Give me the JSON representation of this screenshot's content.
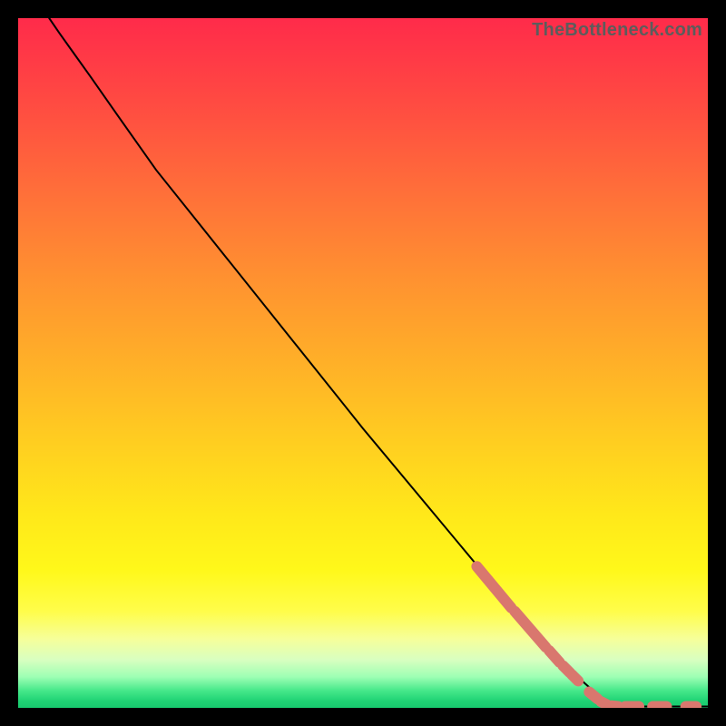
{
  "watermark": "TheBottleneck.com",
  "chart_data": {
    "type": "line",
    "title": "",
    "xlabel": "",
    "ylabel": "",
    "xlim": [
      0,
      100
    ],
    "ylim": [
      0,
      100
    ],
    "grid": false,
    "series": [
      {
        "name": "curve",
        "color": "#000000",
        "points": [
          {
            "x": 4.5,
            "y": 100
          },
          {
            "x": 6.0,
            "y": 97.8
          },
          {
            "x": 8.0,
            "y": 95.0
          },
          {
            "x": 10.5,
            "y": 91.5
          },
          {
            "x": 14.0,
            "y": 86.5
          },
          {
            "x": 20.0,
            "y": 78.0
          },
          {
            "x": 30.0,
            "y": 65.5
          },
          {
            "x": 40.0,
            "y": 53.0
          },
          {
            "x": 50.0,
            "y": 40.5
          },
          {
            "x": 60.0,
            "y": 28.5
          },
          {
            "x": 70.0,
            "y": 16.5
          },
          {
            "x": 80.0,
            "y": 5.5
          },
          {
            "x": 85.0,
            "y": 1.0
          },
          {
            "x": 88.0,
            "y": 0.2
          },
          {
            "x": 95.0,
            "y": 0.2
          },
          {
            "x": 100.0,
            "y": 0.2
          }
        ]
      },
      {
        "name": "highlight-segments",
        "color": "#d9776e",
        "style": "thick-dash",
        "segments": [
          {
            "x1": 66.5,
            "y1": 20.5,
            "x2": 71.5,
            "y2": 14.5
          },
          {
            "x1": 72.0,
            "y1": 14.0,
            "x2": 76.5,
            "y2": 8.8
          },
          {
            "x1": 77.0,
            "y1": 8.3,
            "x2": 78.5,
            "y2": 6.6
          },
          {
            "x1": 79.0,
            "y1": 6.1,
            "x2": 80.0,
            "y2": 5.1
          },
          {
            "x1": 80.3,
            "y1": 4.8,
            "x2": 81.2,
            "y2": 3.9
          },
          {
            "x1": 82.8,
            "y1": 2.3,
            "x2": 84.0,
            "y2": 1.3
          },
          {
            "x1": 84.5,
            "y1": 0.9,
            "x2": 85.3,
            "y2": 0.5
          },
          {
            "x1": 86.0,
            "y1": 0.3,
            "x2": 87.0,
            "y2": 0.2
          },
          {
            "x1": 88.0,
            "y1": 0.2,
            "x2": 90.0,
            "y2": 0.2
          },
          {
            "x1": 92.0,
            "y1": 0.2,
            "x2": 94.0,
            "y2": 0.2
          },
          {
            "x1": 96.8,
            "y1": 0.2,
            "x2": 98.3,
            "y2": 0.2
          }
        ]
      }
    ],
    "background": {
      "type": "vertical-gradient",
      "stops": [
        {
          "pos": 0.0,
          "color": "#ff2b4a"
        },
        {
          "pos": 0.5,
          "color": "#ffb028"
        },
        {
          "pos": 0.8,
          "color": "#fff81a"
        },
        {
          "pos": 0.95,
          "color": "#9effb4"
        },
        {
          "pos": 1.0,
          "color": "#18c96e"
        }
      ]
    }
  },
  "colors": {
    "frame": "#000000",
    "curve": "#000000",
    "highlight": "#d9776e",
    "watermark": "#5c5c5c"
  }
}
